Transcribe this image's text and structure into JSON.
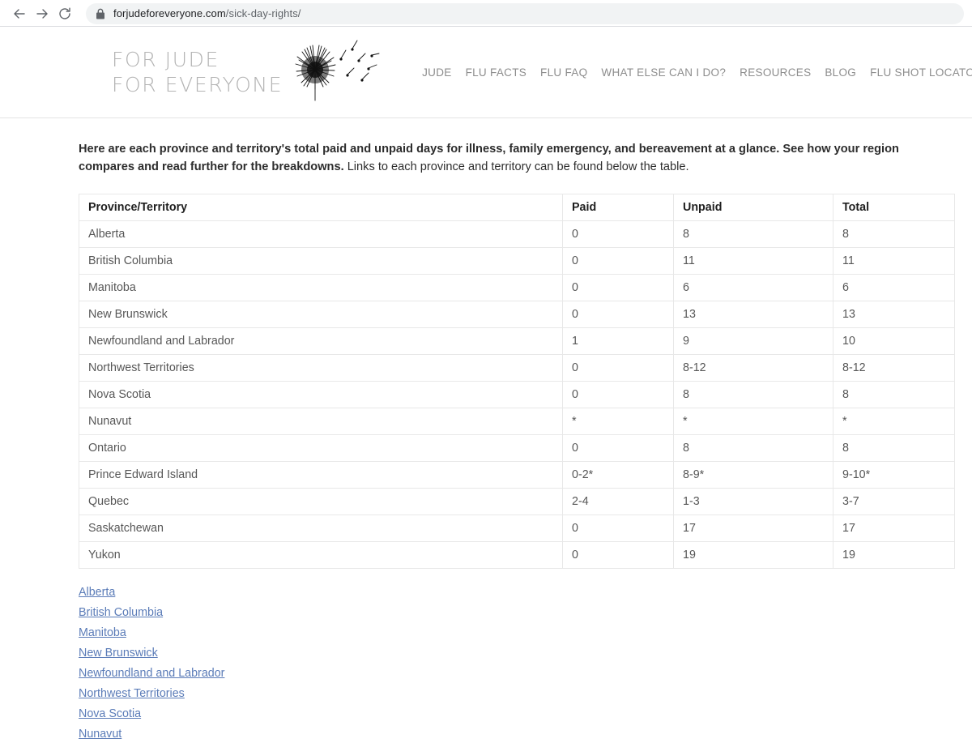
{
  "browser": {
    "back_icon": "back-arrow-icon",
    "forward_icon": "forward-arrow-icon",
    "reload_icon": "reload-icon",
    "lock_icon": "lock-icon",
    "url_domain": "forjudeforeveryone.com",
    "url_path": "/sick-day-rights/"
  },
  "site_header": {
    "logo_line1": "FOR JUDE",
    "logo_line2": "FOR EVERYONE",
    "logo_icon": "dandelion-icon",
    "nav": [
      {
        "label": "JUDE"
      },
      {
        "label": "FLU FACTS"
      },
      {
        "label": "FLU FAQ"
      },
      {
        "label": "WHAT ELSE CAN I DO?"
      },
      {
        "label": "RESOURCES"
      },
      {
        "label": "BLOG"
      },
      {
        "label": "FLU SHOT LOCATOR"
      }
    ]
  },
  "content": {
    "intro_bold": "Here are each province and territory's total paid and unpaid days for illness, family emergency, and bereavement at a glance. See how your region compares and read further for the breakdowns.",
    "intro_rest": " Links to each province and territory can be found below the table.",
    "table": {
      "columns": [
        "Province/Territory",
        "Paid",
        "Unpaid",
        "Total"
      ],
      "rows": [
        {
          "province": "Alberta",
          "paid": "0",
          "unpaid": "8",
          "total": "8"
        },
        {
          "province": "British Columbia",
          "paid": "0",
          "unpaid": "11",
          "total": "11"
        },
        {
          "province": "Manitoba",
          "paid": "0",
          "unpaid": "6",
          "total": "6"
        },
        {
          "province": "New Brunswick",
          "paid": "0",
          "unpaid": "13",
          "total": "13"
        },
        {
          "province": "Newfoundland and Labrador",
          "paid": "1",
          "unpaid": "9",
          "total": "10"
        },
        {
          "province": "Northwest Territories",
          "paid": "0",
          "unpaid": "8-12",
          "total": "8-12"
        },
        {
          "province": "Nova Scotia",
          "paid": "0",
          "unpaid": "8",
          "total": "8"
        },
        {
          "province": "Nunavut",
          "paid": "*",
          "unpaid": "*",
          "total": "*"
        },
        {
          "province": "Ontario",
          "paid": "0",
          "unpaid": "8",
          "total": "8"
        },
        {
          "province": "Prince Edward Island",
          "paid": "0-2*",
          "unpaid": "8-9*",
          "total": "9-10*"
        },
        {
          "province": "Quebec",
          "paid": "2-4",
          "unpaid": "1-3",
          "total": "3-7"
        },
        {
          "province": "Saskatchewan",
          "paid": "0",
          "unpaid": "17",
          "total": "17"
        },
        {
          "province": "Yukon",
          "paid": "0",
          "unpaid": "19",
          "total": "19"
        }
      ]
    },
    "links": [
      {
        "label": "Alberta"
      },
      {
        "label": "British Columbia"
      },
      {
        "label": "Manitoba"
      },
      {
        "label": "New Brunswick"
      },
      {
        "label": "Newfoundland and Labrador"
      },
      {
        "label": "Northwest Territories"
      },
      {
        "label": "Nova Scotia"
      },
      {
        "label": "Nunavut"
      }
    ]
  },
  "colors": {
    "link": "#5b7cb8",
    "logo_gray": "#b3b3b3",
    "nav_gray": "#8d8d8d",
    "table_border": "#e8e8e8"
  }
}
